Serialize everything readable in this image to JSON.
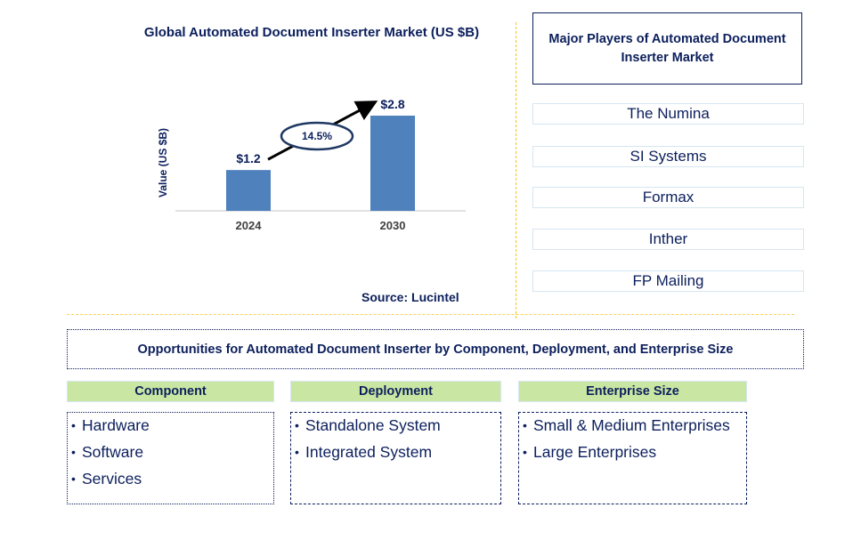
{
  "chart_data": {
    "type": "bar",
    "title": "Global Automated Document Inserter Market (US $B)",
    "xlabel": "",
    "ylabel": "Value (US $B)",
    "categories": [
      "2024",
      "2030"
    ],
    "values": [
      1.2,
      2.8
    ],
    "data_labels": [
      "$1.2",
      "$2.8"
    ],
    "ylim": [
      0,
      2.8
    ],
    "grid": false,
    "bar_color": "#4f81bd",
    "annotation": {
      "type": "cagr-arrow",
      "text": "14.5%",
      "from": "2024",
      "to": "2030"
    },
    "source": "Source: Lucintel"
  },
  "players": {
    "title": "Major Players of Automated Document Inserter Market",
    "items": [
      "The Numina",
      "SI Systems",
      "Formax",
      "Inther",
      "FP Mailing"
    ]
  },
  "opportunities": {
    "title": "Opportunities for Automated Document Inserter by Component, Deployment, and Enterprise Size",
    "segments": [
      {
        "label": "Component",
        "items": [
          "Hardware",
          "Software",
          "Services"
        ]
      },
      {
        "label": "Deployment",
        "items": [
          "Standalone System",
          "Integrated System"
        ]
      },
      {
        "label": "Enterprise Size",
        "items": [
          "Small & Medium Enterprises",
          "Large Enterprises"
        ]
      }
    ]
  },
  "colors": {
    "text_primary": "#0c1f5c",
    "bar": "#4f81bd",
    "segment_header_bg": "#c9e6a3",
    "divider": "#ffc000",
    "player_border": "#d6e6f2"
  },
  "bullet_glyph": "•"
}
